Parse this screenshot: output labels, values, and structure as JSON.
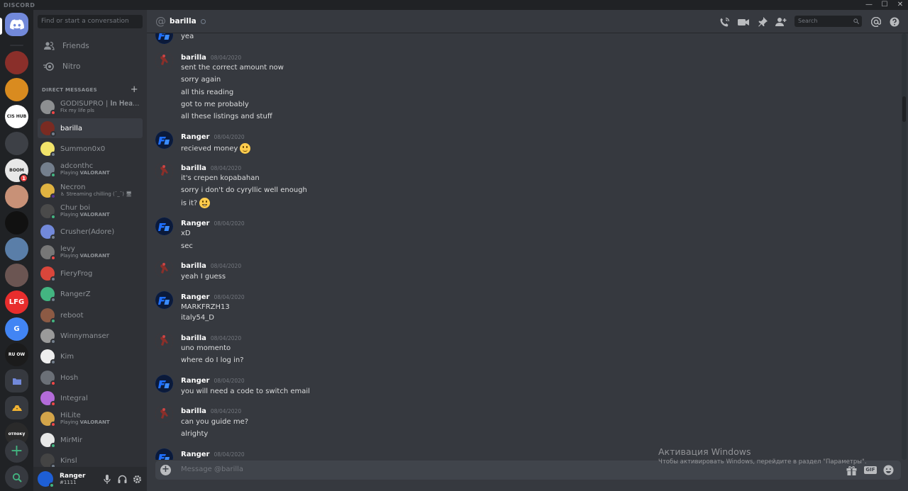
{
  "window": {
    "brand": "DISCORD",
    "controls": [
      "—",
      "☐",
      "✕"
    ]
  },
  "servers": {
    "home_icon": "discord-logo-icon",
    "avatars": [
      {
        "color": "#8a2f2a",
        "text": ""
      },
      {
        "color": "#d98b1f",
        "text": ""
      },
      {
        "color": "#ffffff",
        "text": "CIS HUB"
      },
      {
        "color": "#3d4046",
        "text": ""
      },
      {
        "color": "#e8e8e8",
        "text": "BOOM"
      },
      {
        "color": "#c89177",
        "text": ""
      },
      {
        "color": "#111111",
        "text": ""
      },
      {
        "color": "#5a7ea8",
        "text": ""
      },
      {
        "color": "#6b5552",
        "text": ""
      },
      {
        "color": "#e82d2d",
        "text": "LFG"
      },
      {
        "color": "#4285f4",
        "text": "G"
      },
      {
        "color": "#1b1b1b",
        "text": "RU OW"
      },
      {
        "color": "#36393f",
        "text": ""
      },
      {
        "color": "#36393f",
        "text": ""
      },
      {
        "color": "#2a2a2a",
        "text": "отпоку"
      }
    ],
    "badge": "1",
    "add_icon": "plus-icon",
    "explore_icon": "compass-icon"
  },
  "dm_sidebar": {
    "search_placeholder": "Find or start a conversation",
    "friends": "Friends",
    "nitro": "Nitro",
    "section_title": "DIRECT MESSAGES",
    "dms": [
      {
        "name": "GODISUPRO | 𝐈𝐧 𝐇𝐞𝐚...",
        "sub": "Fix my life pls",
        "sub_bold": "",
        "color": "#8d8f91",
        "status": "#f04747"
      },
      {
        "name": "barilla",
        "sub": "",
        "sub_bold": "",
        "color": "#7a2b22",
        "status": "#747f8d",
        "active": true
      },
      {
        "name": "Summon0x0",
        "sub": "",
        "sub_bold": "",
        "color": "#f1e36a",
        "status": "#747f8d"
      },
      {
        "name": "adconthc",
        "sub": "Playing ",
        "sub_bold": "VALORANT",
        "color": "#747f8d",
        "status": "#43b581"
      },
      {
        "name": "Necron",
        "sub": "♿ Streaming chilling (¯_¯) 🖥",
        "sub_bold": "",
        "color": "#e0b341",
        "status": "#593695"
      },
      {
        "name": "Chur boi",
        "sub": "Playing ",
        "sub_bold": "VALORANT",
        "color": "#4a4a4a",
        "status": "#43b581"
      },
      {
        "name": "Crusher(Adore)",
        "sub": "",
        "sub_bold": "",
        "color": "#7289da",
        "status": "#747f8d"
      },
      {
        "name": "levy",
        "sub": "Playing ",
        "sub_bold": "VALORANT",
        "color": "#777777",
        "status": "#f04747"
      },
      {
        "name": "FieryFrog",
        "sub": "",
        "sub_bold": "",
        "color": "#d9463b",
        "status": "#747f8d"
      },
      {
        "name": "RangerZ",
        "sub": "",
        "sub_bold": "",
        "color": "#43b581",
        "status": "#747f8d"
      },
      {
        "name": "reboot",
        "sub": "",
        "sub_bold": "",
        "color": "#8c5a44",
        "status": "#43b581"
      },
      {
        "name": "Winnymanser",
        "sub": "",
        "sub_bold": "",
        "color": "#9a9a9a",
        "status": "#747f8d"
      },
      {
        "name": "Kim",
        "sub": "",
        "sub_bold": "",
        "color": "#eeeeee",
        "status": "#747f8d"
      },
      {
        "name": "Hosh",
        "sub": "",
        "sub_bold": "",
        "color": "#6b7077",
        "status": "#f04747"
      },
      {
        "name": "Integral",
        "sub": "",
        "sub_bold": "",
        "color": "#b36bd9",
        "status": "#f04747"
      },
      {
        "name": "HiLite",
        "sub": "Playing ",
        "sub_bold": "VALORANT",
        "color": "#d4a54a",
        "status": "#f04747"
      },
      {
        "name": "MirMir",
        "sub": "",
        "sub_bold": "",
        "color": "#e8e8e8",
        "status": "#43b581"
      },
      {
        "name": "Kinsl",
        "sub": "",
        "sub_bold": "",
        "color": "#444444",
        "status": "#747f8d"
      }
    ]
  },
  "user_panel": {
    "username": "Ranger",
    "tag": "#1111"
  },
  "chat": {
    "at_symbol": "@",
    "channel_name": "barilla",
    "search_placeholder": "Search",
    "composer_placeholder": "Message @barilla",
    "composer_add": "+",
    "messages": [
      {
        "author": "",
        "time": "",
        "avatar": "#1e5fd6",
        "lines": [
          "yea"
        ]
      },
      {
        "author": "barilla",
        "time": "08/04/2020",
        "avatar": "#7a2b22",
        "lines": [
          "sent the correct amount now",
          "sorry again",
          "all this reading",
          "got to me probably",
          "all these listings and stuff"
        ]
      },
      {
        "author": "Ranger",
        "time": "08/04/2020",
        "avatar": "#1e5fd6",
        "lines": [
          "recieved money"
        ],
        "emoji": "slight-smile"
      },
      {
        "author": "barilla",
        "time": "08/04/2020",
        "avatar": "#7a2b22",
        "lines": [
          "it's crepen kopabahan",
          "sorry i don't do cyryllic well enough",
          "is it?"
        ],
        "emoji": "grin"
      },
      {
        "author": "Ranger",
        "time": "08/04/2020",
        "avatar": "#1e5fd6",
        "lines": [
          "xD",
          "sec"
        ]
      },
      {
        "author": "barilla",
        "time": "08/04/2020",
        "avatar": "#7a2b22",
        "lines": [
          "yeah I guess"
        ]
      },
      {
        "author": "Ranger",
        "time": "08/04/2020",
        "avatar": "#1e5fd6",
        "lines": [
          "MARKFRZH13",
          "italy54_D"
        ]
      },
      {
        "author": "barilla",
        "time": "08/04/2020",
        "avatar": "#7a2b22",
        "lines": [
          "uno momento",
          "where do I log in?"
        ]
      },
      {
        "author": "Ranger",
        "time": "08/04/2020",
        "avatar": "#1e5fd6",
        "lines": [
          "you will need a code to switch email"
        ]
      },
      {
        "author": "barilla",
        "time": "08/04/2020",
        "avatar": "#7a2b22",
        "lines": [
          "can you guide me?",
          "alrighty"
        ]
      },
      {
        "author": "Ranger",
        "time": "08/04/2020",
        "avatar": "#1e5fd6",
        "lines": []
      }
    ]
  },
  "watermark": {
    "title": "Активация Windows",
    "text": "Чтобы активировать Windows, перейдите в раздел \"Параметры\"."
  },
  "gif_label": "GIF"
}
